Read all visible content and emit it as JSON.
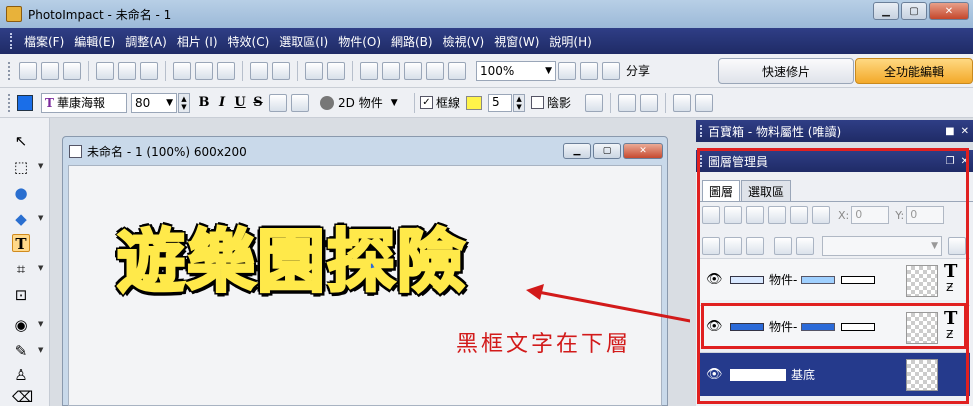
{
  "window": {
    "title": "PhotoImpact - 未命名 - 1"
  },
  "menu": [
    "檔案(F)",
    "編輯(E)",
    "調整(A)",
    "相片 (I)",
    "特效(C)",
    "選取區(I)",
    "物件(O)",
    "網路(B)",
    "檢視(V)",
    "視窗(W)",
    "說明(H)"
  ],
  "toolbar": {
    "zoom": "100%",
    "share_label": "分享",
    "quick_fix_label": "快速修片",
    "full_edit_label": "全功能編輯"
  },
  "text_toolbar": {
    "font": "華康海報",
    "font_size": "80",
    "bold": "B",
    "italic": "I",
    "underline": "U",
    "strike": "S",
    "object_mode": "2D 物件",
    "border_label": "框線",
    "border_width": "5",
    "shadow_label": "陰影",
    "text_color": "#1a6ee8",
    "border_color": "#fff44a"
  },
  "document": {
    "title": "未命名 - 1 (100%) 600x200",
    "art_text": "遊樂園探險"
  },
  "annotation": {
    "text": "黑框文字在下層",
    "color": "#d21a1a"
  },
  "panels": {
    "materials_title": "百寶箱 - 物料屬性 (唯讀)",
    "layer_manager_title": "圖層管理員",
    "tabs": [
      "圖層",
      "選取區"
    ],
    "x_label": "X:",
    "x_value": "0",
    "y_label": "Y:",
    "y_value": "0",
    "layers": [
      {
        "name": "物件-"
      },
      {
        "name": "物件-"
      },
      {
        "name": "基底"
      }
    ]
  }
}
